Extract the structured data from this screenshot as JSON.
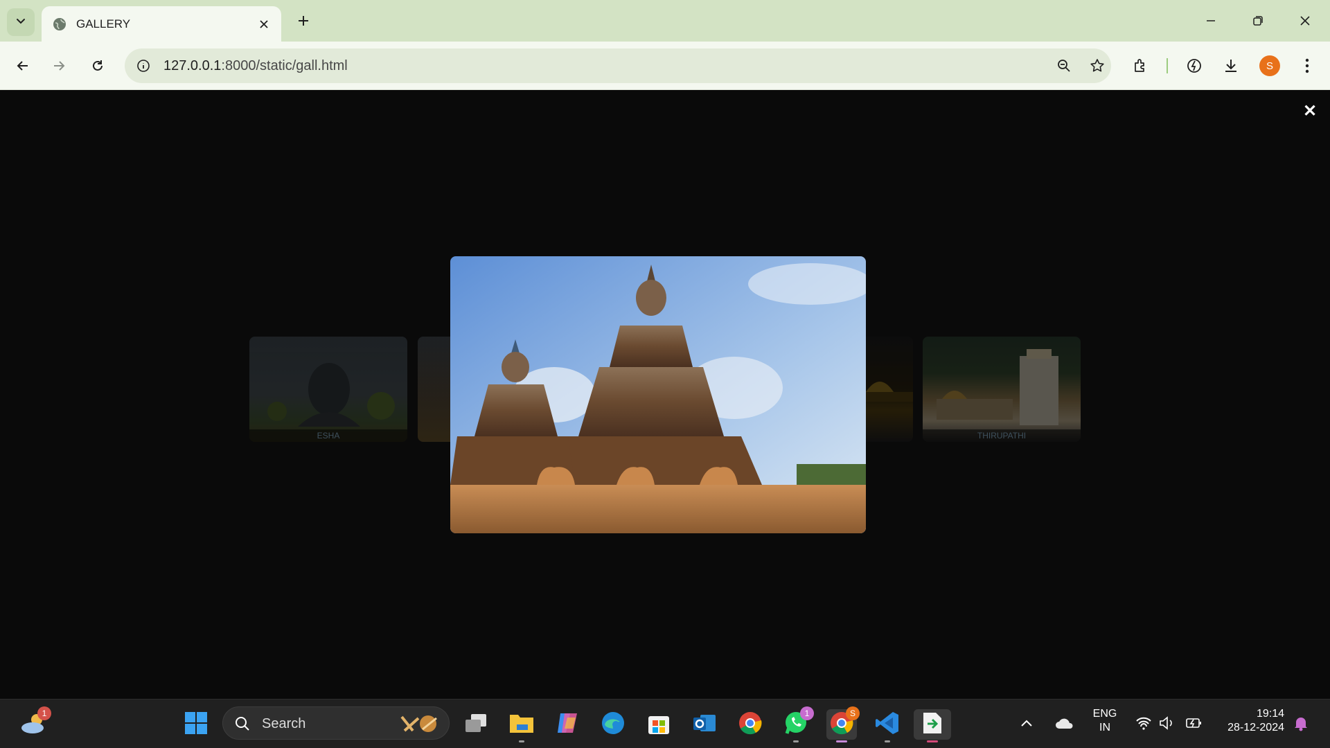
{
  "browser": {
    "tab_title": "GALLERY",
    "url_host": "127.0.0.1",
    "url_path": ":8000/static/gall.html",
    "profile_initial": "S"
  },
  "gallery": {
    "thumbnails": [
      {
        "caption": "ESHA"
      },
      {
        "caption": ""
      },
      {
        "caption": ""
      },
      {
        "caption": "THIRUPATHI"
      }
    ],
    "close_symbol": "✕"
  },
  "taskbar": {
    "weather_badge": "1",
    "search_label": "Search",
    "whatsapp_badge": "1",
    "chrome_profile_badge": "S",
    "language_line1": "ENG",
    "language_line2": "IN",
    "time": "19:14",
    "date": "28-12-2024"
  }
}
